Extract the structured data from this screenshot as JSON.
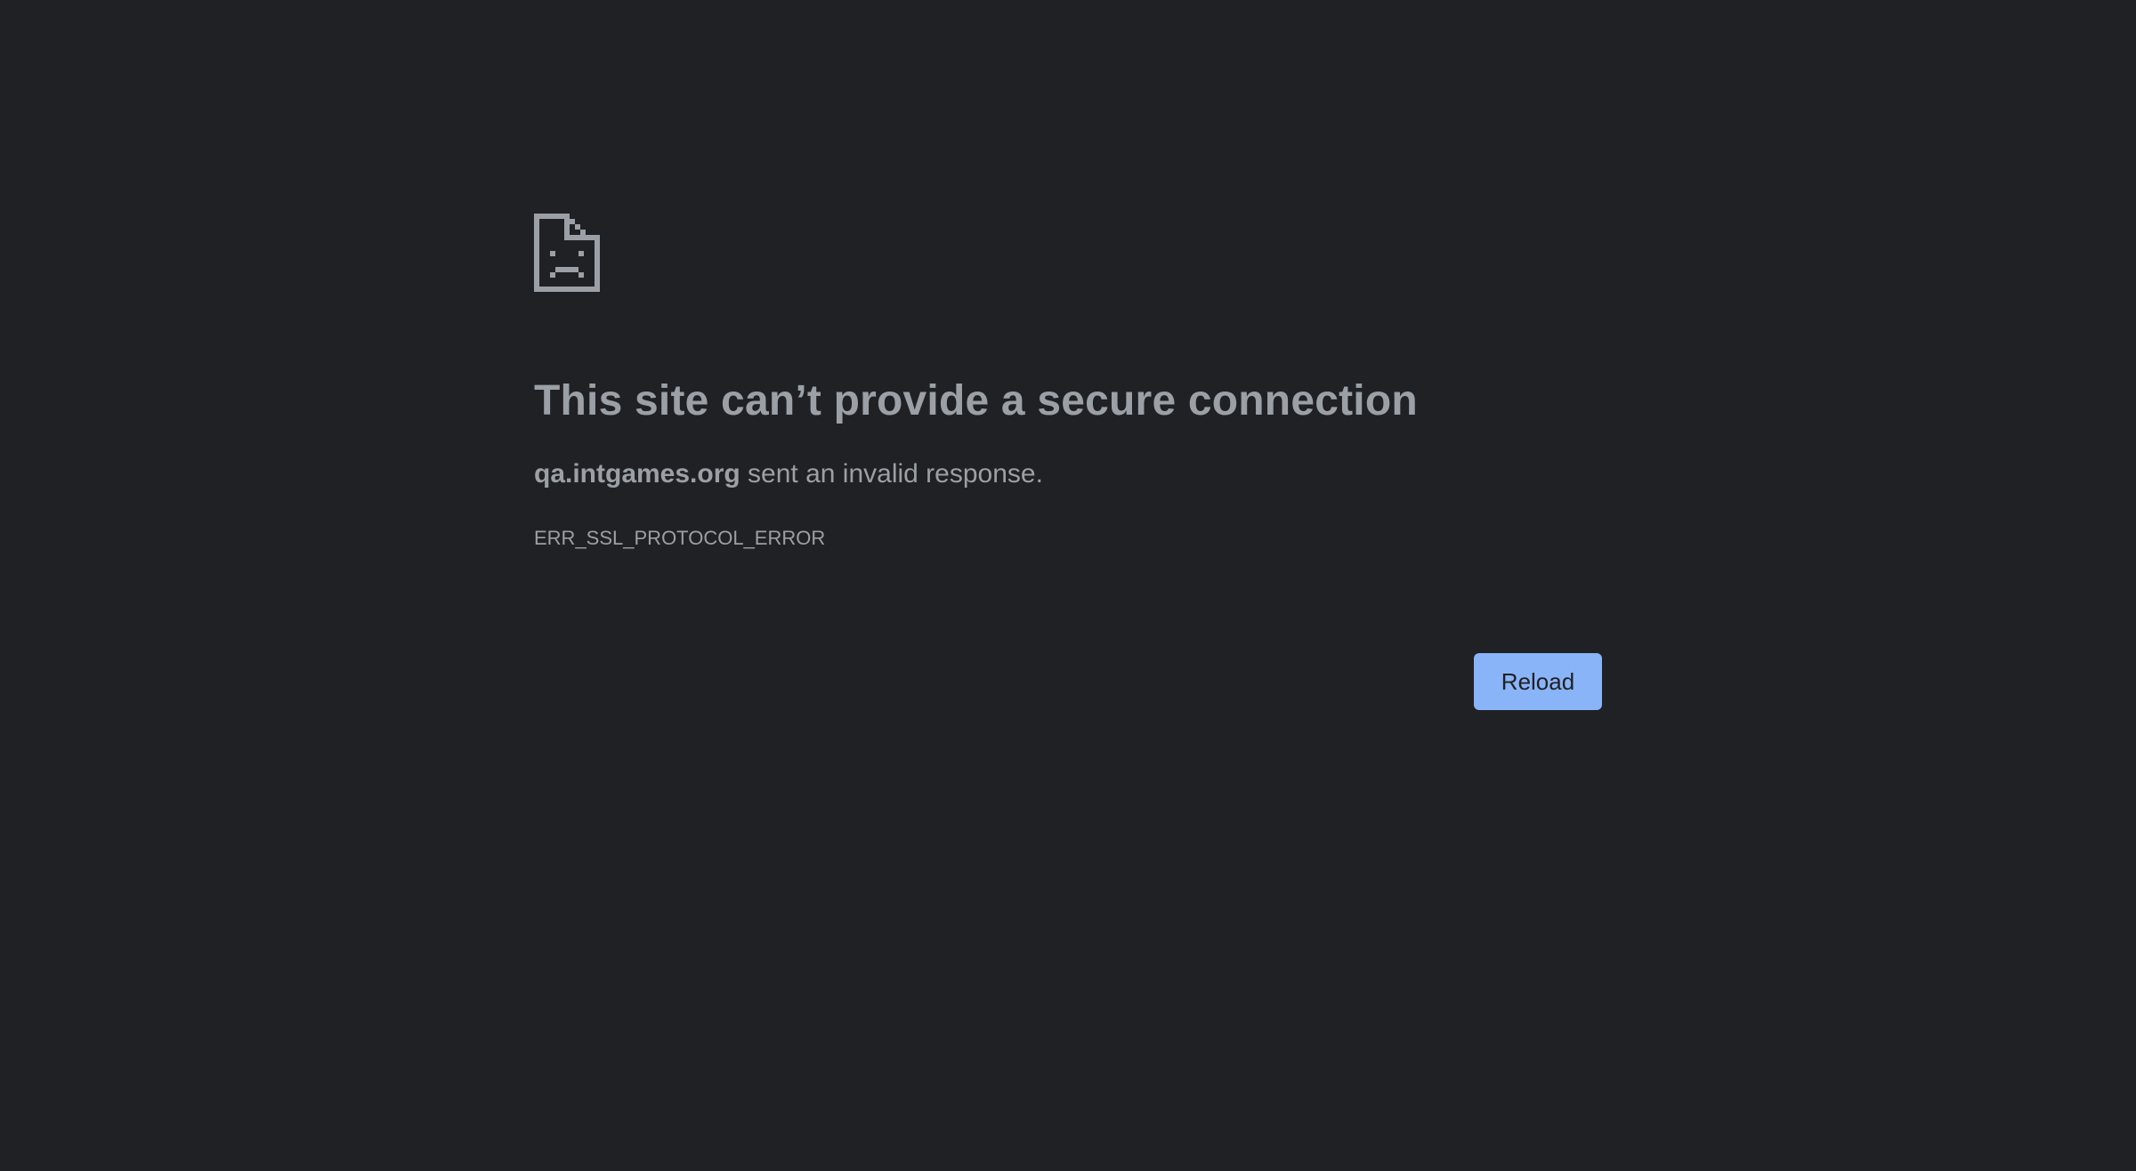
{
  "error": {
    "icon": "sad-document-icon",
    "title": "This site can’t provide a secure connection",
    "host": "qa.intgames.org",
    "message_suffix": " sent an invalid response.",
    "code": "ERR_SSL_PROTOCOL_ERROR"
  },
  "actions": {
    "reload_label": "Reload"
  },
  "colors": {
    "background": "#202124",
    "text": "#9aa0a6",
    "button_bg": "#8ab4f8",
    "button_text": "#202124"
  }
}
